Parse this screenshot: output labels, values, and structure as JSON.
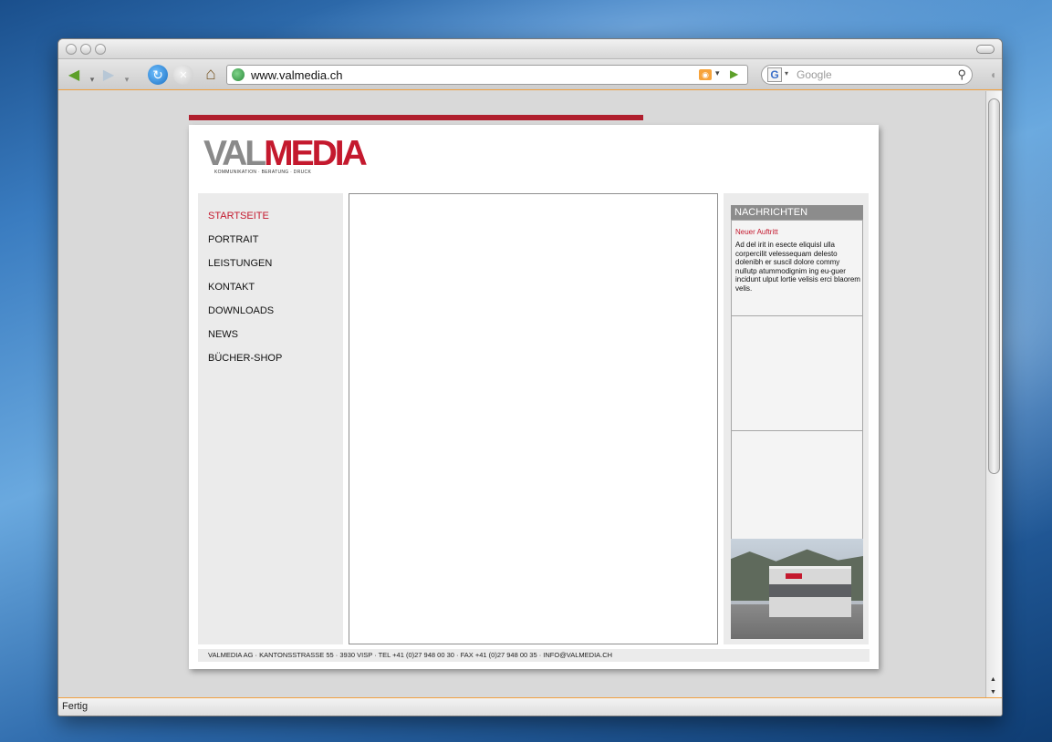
{
  "browser": {
    "url": "www.valmedia.ch",
    "search_placeholder": "Google",
    "search_engine_glyph": "G",
    "status": "Fertig",
    "accent_color": "#f0a040"
  },
  "site": {
    "logo": {
      "word_left": "VAL",
      "word_right": "MEDIA",
      "tagline": "KOMMUNIKATION  ·  BERATUNG  ·  DRUCK"
    },
    "brand_red": "#c4192e",
    "nav": [
      {
        "label": "STARTSEITE",
        "active": true
      },
      {
        "label": "PORTRAIT"
      },
      {
        "label": "LEISTUNGEN"
      },
      {
        "label": "KONTAKT"
      },
      {
        "label": "DOWNLOADS"
      },
      {
        "label": "NEWS"
      },
      {
        "label": "BÜCHER-SHOP"
      }
    ],
    "news": {
      "header": "NACHRICHTEN",
      "title": "Neuer Auftritt",
      "body": "Ad del irit in esecte eliquisl ulla corpercilit velessequam delesto dolenibh er suscil dolore commy nullutp atummodignim ing eu-guer incidunt ulput lortie velisis erci blaorem velis."
    },
    "footer": "VALMEDIA AG · KANTONSSTRASSE 55 · 3930 VISP · TEL +41 (0)27 948 00 30 · FAX +41 (0)27 948 00 35 · INFO@VALMEDIA.CH"
  },
  "icons": [
    "back-icon",
    "forward-icon",
    "reload-icon",
    "stop-icon",
    "home-icon",
    "globe-icon",
    "rss-icon",
    "go-icon",
    "google-icon",
    "search-icon"
  ]
}
